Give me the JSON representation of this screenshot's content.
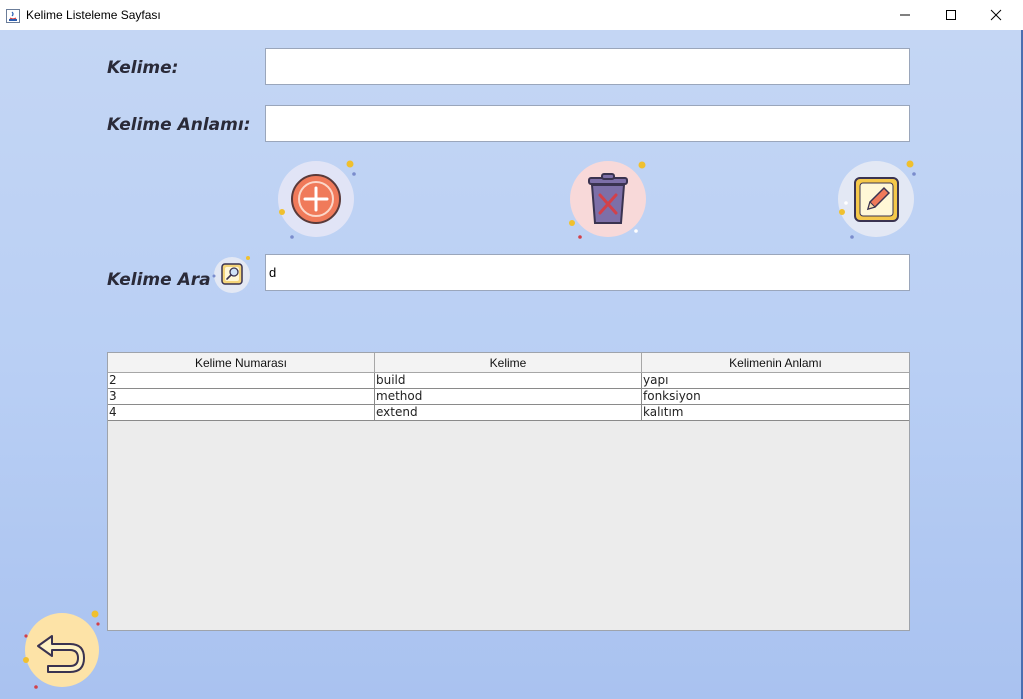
{
  "window": {
    "title": "Kelime Listeleme Sayfası",
    "controls": [
      "minimize-icon",
      "maximize-icon",
      "close-icon"
    ]
  },
  "form": {
    "word_label": "Kelime:",
    "word_value": "",
    "meaning_label": "Kelime Anlamı:",
    "meaning_value": "",
    "search_label": "Kelime Ara",
    "search_value": "d"
  },
  "actions": {
    "add_icon": "add-circle-icon",
    "delete_icon": "trash-delete-icon",
    "edit_icon": "pencil-edit-icon",
    "search_icon": "magnifier-icon",
    "back_icon": "back-arrow-icon"
  },
  "table": {
    "columns": [
      "Kelime Numarası",
      "Kelime",
      "Kelimenin Anlamı"
    ],
    "rows": [
      [
        "2",
        "build",
        "yapı"
      ],
      [
        "3",
        "method",
        "fonksiyon"
      ],
      [
        "4",
        "extend",
        "kalıtım"
      ]
    ]
  },
  "colors": {
    "background_top": "#c4d6f4",
    "background_bottom": "#a9c2f0",
    "add_accent": "#f07a5a",
    "delete_accent": "#7d6fa8",
    "edit_accent": "#f5c84a",
    "back_bg": "#fde3a7"
  }
}
